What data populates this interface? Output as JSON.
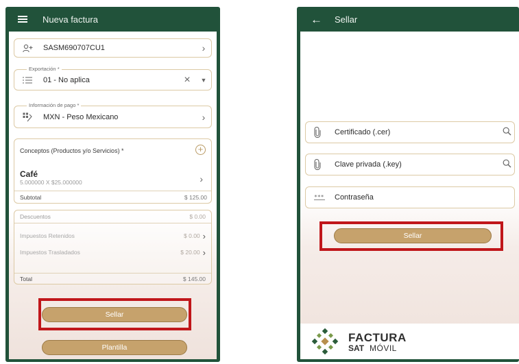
{
  "left": {
    "header": {
      "title": "Nueva factura"
    },
    "receptor": {
      "value": "SASM690707CU1"
    },
    "exportacion": {
      "label": "Exportación *",
      "value": "01 - No aplica"
    },
    "pago": {
      "label": "Información de pago *",
      "value": "MXN - Peso Mexicano"
    },
    "conceptos": {
      "title": "Conceptos (Productos y/o Servicios) *",
      "item_name": "Café",
      "item_detail": "5.000000 X $25.000000",
      "subtotal_label": "Subtotal",
      "subtotal_value": "$ 125.00"
    },
    "totals": {
      "descuentos_label": "Descuentos",
      "descuentos_value": "$ 0.00",
      "retenidos_label": "Impuestos Retenidos",
      "retenidos_value": "$ 0.00",
      "trasladados_label": "Impuestos Trasladados",
      "trasladados_value": "$ 20.00",
      "total_label": "Total",
      "total_value": "$ 145.00"
    },
    "buttons": {
      "sellar": "Sellar",
      "plantilla": "Plantilla"
    }
  },
  "right": {
    "header": {
      "title": "Sellar"
    },
    "fields": {
      "certificado": "Certificado (.cer)",
      "clave": "Clave privada (.key)",
      "contrasena": "Contraseña"
    },
    "buttons": {
      "sellar": "Sellar"
    },
    "logo": {
      "factura": "FACTURA",
      "sat": "SAT",
      "movil": "MÓVIL"
    }
  },
  "colors": {
    "appbar": "#21523a",
    "button": "#c6a26c",
    "field_border": "#dcc9a4",
    "highlight": "#c0161a"
  },
  "icons": {
    "menu": "menu-icon",
    "back": "arrow-left-icon",
    "receptor": "add-person-icon",
    "exportacion": "list-icon",
    "pago": "payment-icon",
    "certificado": "paperclip-icon",
    "clave": "paperclip-icon",
    "contrasena": "password-icon",
    "search": "search-icon"
  }
}
